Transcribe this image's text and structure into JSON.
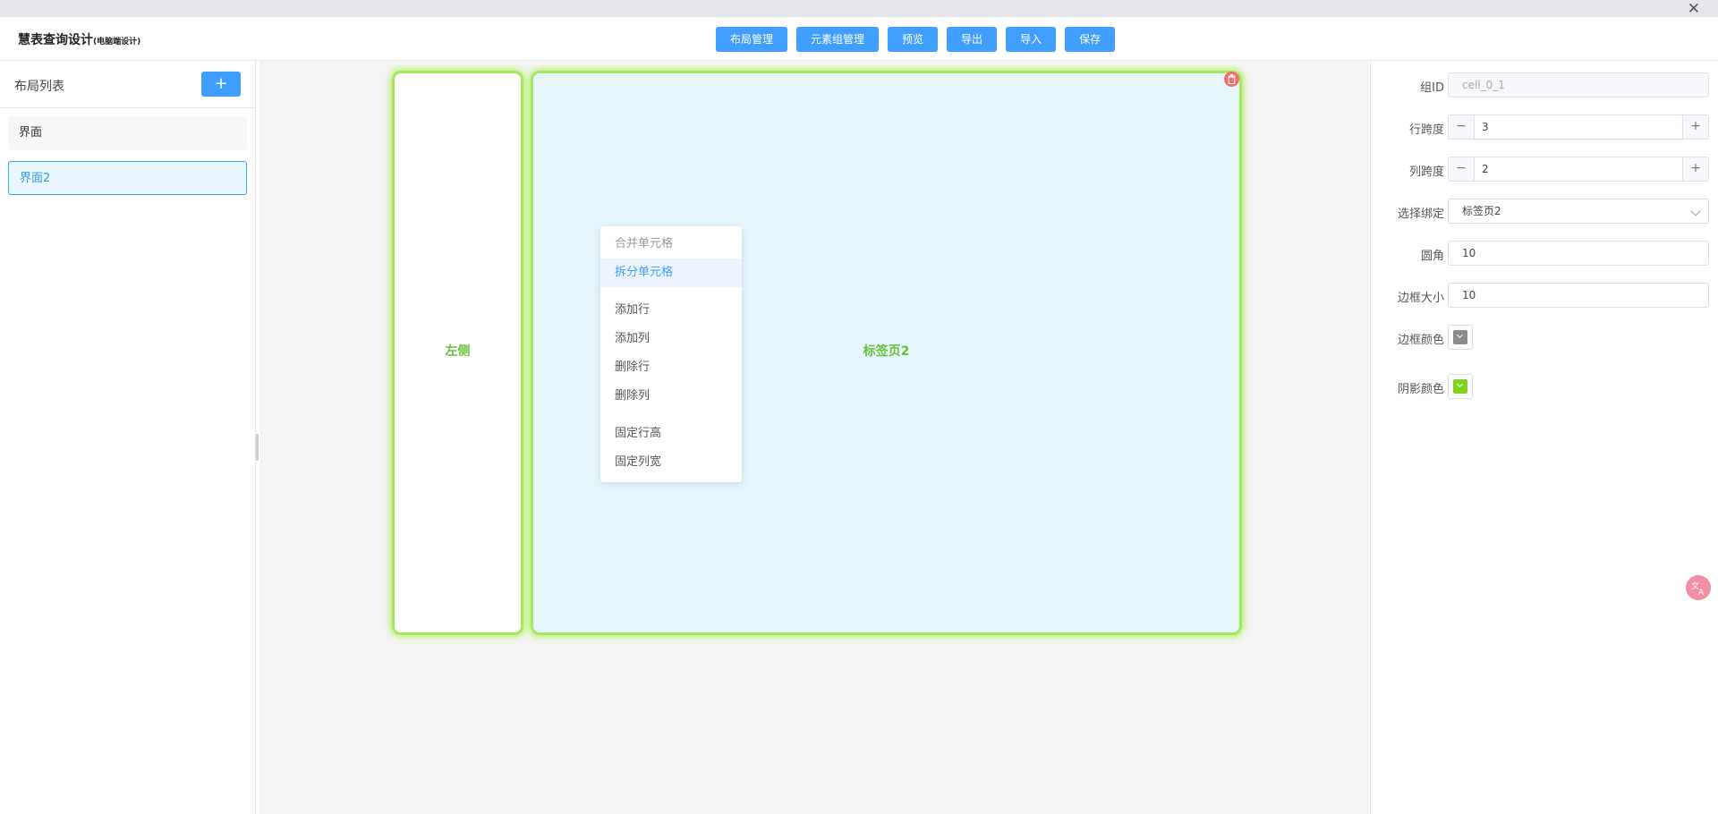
{
  "app": {
    "title": "慧表查询设计",
    "subtitle": "(电脑端设计)"
  },
  "toolbar": {
    "buttons": [
      "布局管理",
      "元素组管理",
      "预览",
      "导出",
      "导入",
      "保存"
    ]
  },
  "layout_list": {
    "title": "布局列表",
    "add_label": "+",
    "items": [
      {
        "label": "界面",
        "active": false
      },
      {
        "label": "界面2",
        "active": true
      }
    ]
  },
  "canvas": {
    "cells": [
      {
        "label": "左侧"
      },
      {
        "label": "标签页2"
      }
    ]
  },
  "context_menu": {
    "items": [
      "合并单元格",
      "拆分单元格",
      "添加行",
      "添加列",
      "删除行",
      "删除列",
      "固定行高",
      "固定列宽"
    ],
    "disabled_item": "合并单元格",
    "highlighted_item": "拆分单元格"
  },
  "properties": {
    "group_id": {
      "label": "组ID",
      "value": "cell_0_1"
    },
    "row_span": {
      "label": "行跨度",
      "value": "3"
    },
    "col_span": {
      "label": "列跨度",
      "value": "2"
    },
    "binding": {
      "label": "选择绑定",
      "value": "标签页2"
    },
    "radius": {
      "label": "圆角",
      "value": "10"
    },
    "border_size": {
      "label": "边框大小",
      "value": "10"
    },
    "border_color": {
      "label": "边框颜色",
      "color": "#8c8c8c"
    },
    "shadow_color": {
      "label": "阴影颜色",
      "color": "#7ed321"
    }
  },
  "colors": {
    "primary": "#409eff",
    "cell_border": "#a5e85f",
    "cell_label": "#67c23a",
    "delete": "#f56c6c"
  }
}
